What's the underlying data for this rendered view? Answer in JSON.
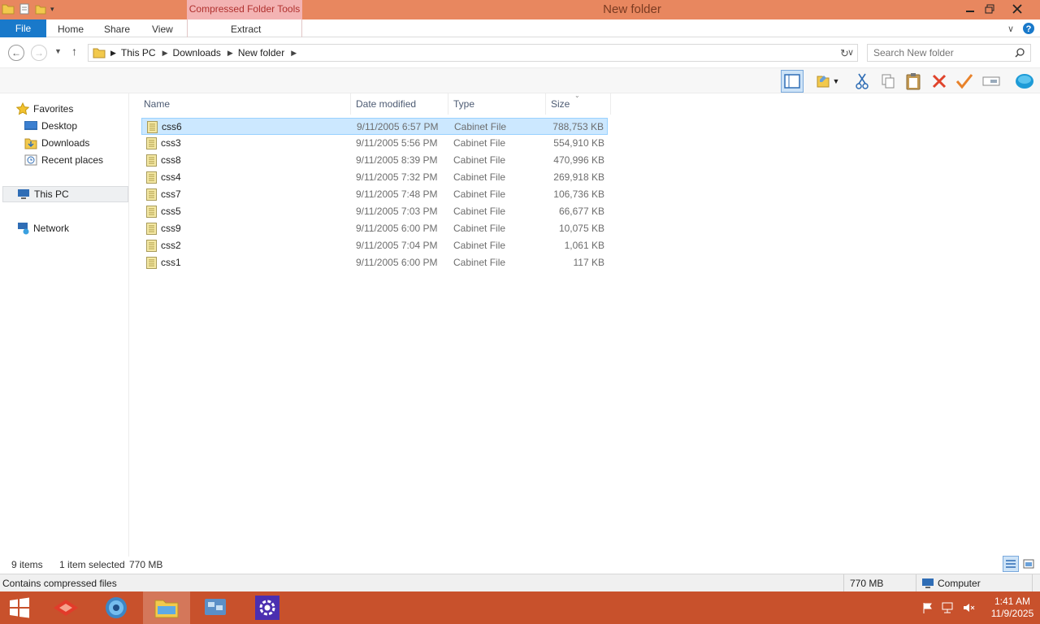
{
  "window": {
    "title": "New folder",
    "context_tab": "Compressed Folder Tools"
  },
  "ribbon": {
    "tabs": [
      "File",
      "Home",
      "Share",
      "View",
      "Extract"
    ]
  },
  "address": {
    "breadcrumb": [
      "This PC",
      "Downloads",
      "New folder"
    ],
    "search_placeholder": "Search New folder"
  },
  "nav": {
    "favorites": "Favorites",
    "desktop": "Desktop",
    "downloads": "Downloads",
    "recent": "Recent places",
    "thispc": "This PC",
    "network": "Network"
  },
  "columns": {
    "name": "Name",
    "date": "Date modified",
    "type": "Type",
    "size": "Size"
  },
  "files": [
    {
      "name": "css6",
      "date": "9/11/2005 6:57 PM",
      "type": "Cabinet File",
      "size": "788,753 KB",
      "selected": true
    },
    {
      "name": "css3",
      "date": "9/11/2005 5:56 PM",
      "type": "Cabinet File",
      "size": "554,910 KB"
    },
    {
      "name": "css8",
      "date": "9/11/2005 8:39 PM",
      "type": "Cabinet File",
      "size": "470,996 KB"
    },
    {
      "name": "css4",
      "date": "9/11/2005 7:32 PM",
      "type": "Cabinet File",
      "size": "269,918 KB"
    },
    {
      "name": "css7",
      "date": "9/11/2005 7:48 PM",
      "type": "Cabinet File",
      "size": "106,736 KB"
    },
    {
      "name": "css5",
      "date": "9/11/2005 7:03 PM",
      "type": "Cabinet File",
      "size": "66,677 KB"
    },
    {
      "name": "css9",
      "date": "9/11/2005 6:00 PM",
      "type": "Cabinet File",
      "size": "10,075 KB"
    },
    {
      "name": "css2",
      "date": "9/11/2005 7:04 PM",
      "type": "Cabinet File",
      "size": "1,061 KB"
    },
    {
      "name": "css1",
      "date": "9/11/2005 6:00 PM",
      "type": "Cabinet File",
      "size": "117 KB"
    }
  ],
  "status": {
    "item_count": "9 items",
    "selection": "1 item selected",
    "selection_size": "770 MB",
    "description": "Contains compressed files",
    "total_size": "770 MB",
    "zone": "Computer"
  },
  "taskbar": {
    "time": "1:41 AM",
    "date": "11/9/2025"
  },
  "colors": {
    "titlebar": "#e8875f",
    "file_tab": "#1979ca",
    "taskbar": "#c8512c",
    "selection": "#cce8ff"
  }
}
